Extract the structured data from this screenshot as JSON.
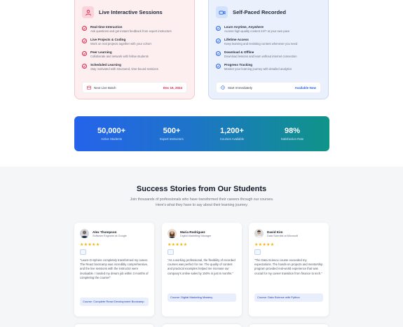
{
  "live_card": {
    "title": "Live Interactive Sessions",
    "accent": "#e11d48",
    "features": [
      {
        "title": "Real-time Interaction",
        "desc": "Ask questions and get instant feedback from expert instructors"
      },
      {
        "title": "Live Projects & Coding",
        "desc": "Work on real projects together with your cohort"
      },
      {
        "title": "Peer Learning",
        "desc": "Collaborate and network with fellow students"
      },
      {
        "title": "Scheduled Learning",
        "desc": "Stay motivated with structured, time-bound sessions"
      }
    ],
    "footer_label": "Next Live Batch",
    "footer_value": "Dec 15, 2024"
  },
  "self_card": {
    "title": "Self-Paced Recorded",
    "accent": "#2563eb",
    "features": [
      {
        "title": "Learn Anytime, Anywhere",
        "desc": "Access high-quality content 24/7 at your own pace"
      },
      {
        "title": "Lifetime Access",
        "desc": "Keep learning and revisiting content whenever you need"
      },
      {
        "title": "Download & Offline",
        "desc": "Download lessons and learn without internet connection"
      },
      {
        "title": "Progress Tracking",
        "desc": "Monitor your learning journey with detailed analytics"
      }
    ],
    "footer_label": "Start Immediately",
    "footer_value": "Available Now"
  },
  "stats": [
    {
      "value": "50,000+",
      "label": "Active Students"
    },
    {
      "value": "500+",
      "label": "Expert Instructors"
    },
    {
      "value": "1,200+",
      "label": "Courses Available"
    },
    {
      "value": "98%",
      "label": "Satisfaction Rate"
    }
  ],
  "success": {
    "title": "Success Stories from Our Students",
    "subtitle": "Join thousands of professionals who have transformed their careers through our courses. Here's what they have to say about their learning journey."
  },
  "testimonials": [
    {
      "name": "Alex Thompson",
      "role": "Software Engineer at Google",
      "stars": "★★★★★",
      "quote": "\"Learn-O-Sphere completely transformed my career. The React bootcamp was incredibly comprehensive, and the live sessions with the instructor were invaluable. I landed my dream job within 3 months of completing the course!\"",
      "course": "Course: Complete React Development Bootcamp"
    },
    {
      "name": "Maria Rodriguez",
      "role": "Digital Marketing Manager",
      "stars": "★★★★★",
      "quote": "\"As a working professional, the flexibility of recorded courses was perfect for me. The quality of content and practical examples helped me increase our company's online sales by 150% in just 6 months.\"",
      "course": "Course: Digital Marketing Mastery"
    },
    {
      "name": "David Kim",
      "role": "Data Scientist at Microsoft",
      "stars": "★★★★★",
      "quote": "\"The Data Science course exceeded my expectations. The hands-on projects and mentorship program provided real-world experience that was crucial for my career transition from finance to tech.\"",
      "course": "Course: Data Science with Python"
    }
  ]
}
